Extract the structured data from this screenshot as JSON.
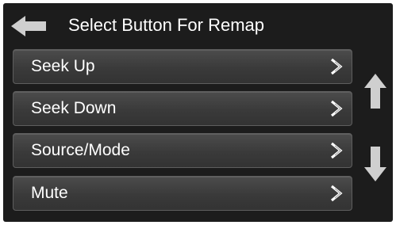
{
  "header": {
    "title": "Select Button For Remap",
    "back_icon": "arrow-left-icon"
  },
  "menu": {
    "items": [
      {
        "label": "Seek Up",
        "icon": "chevron-right-icon"
      },
      {
        "label": "Seek Down",
        "icon": "chevron-right-icon"
      },
      {
        "label": "Source/Mode",
        "icon": "chevron-right-icon"
      },
      {
        "label": "Mute",
        "icon": "chevron-right-icon"
      }
    ]
  },
  "scroll": {
    "up_icon": "arrow-up-icon",
    "down_icon": "arrow-down-icon"
  },
  "colors": {
    "background": "#1c1c1c",
    "item_background": "#3a3a3a",
    "item_border": "#5e5e5e",
    "text": "#ffffff",
    "icon": "#cfcfcf"
  }
}
